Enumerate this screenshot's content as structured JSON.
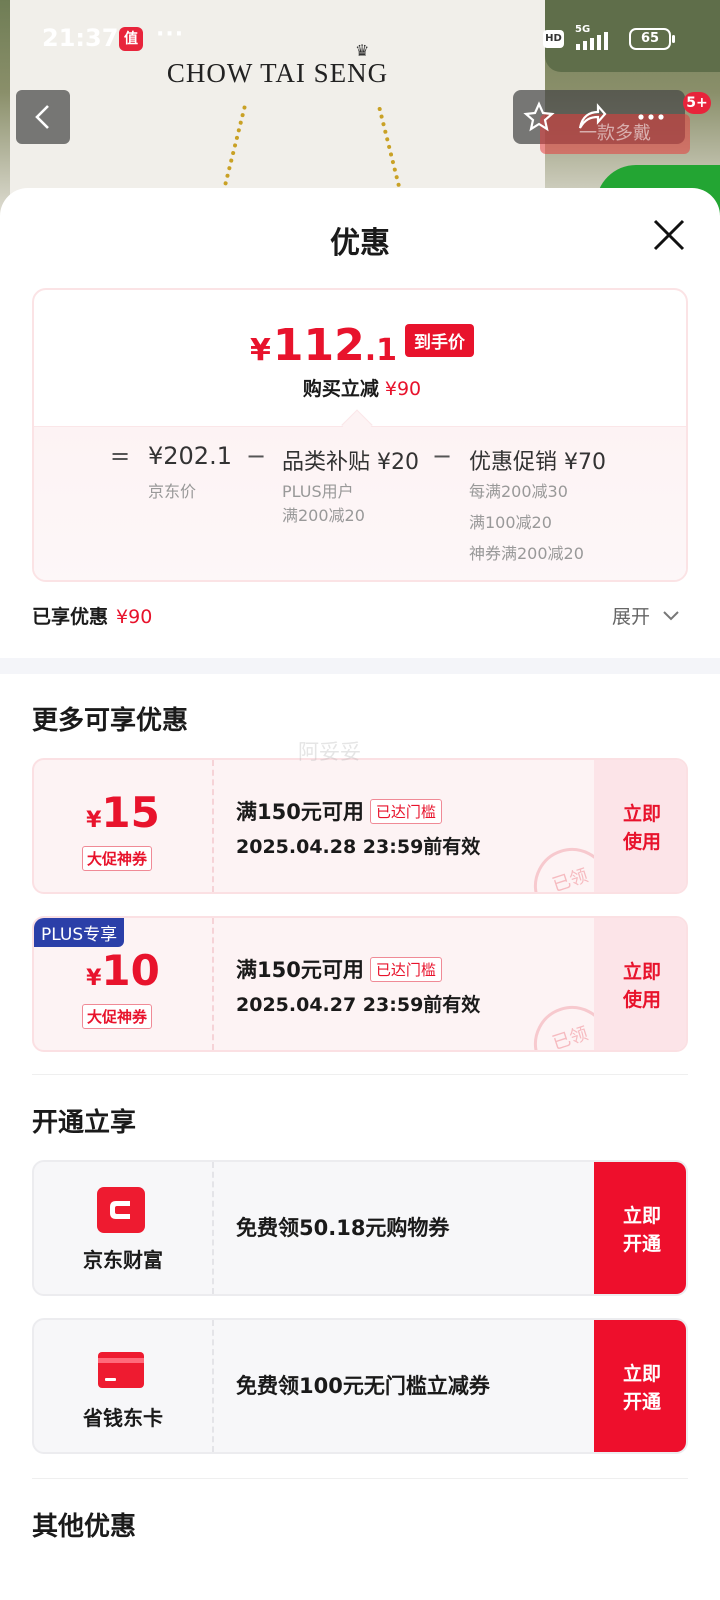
{
  "status_bar": {
    "time": "21:37",
    "app_badge": "值",
    "more_dots": "···",
    "hd": "HD",
    "network": "5G",
    "battery": "65"
  },
  "product_page": {
    "brand": "CHOW TAI SENG",
    "promo_ghost": "一款多戴",
    "cart_count": "5+",
    "icons": [
      "back-icon",
      "star-icon",
      "share-icon",
      "more-icon"
    ]
  },
  "sheet": {
    "title": "优惠",
    "close_icon": "close-icon"
  },
  "price": {
    "currency": "¥",
    "final_int": "112",
    "final_dec": ".1",
    "final_tag": "到手价",
    "discount_label": "购买立减",
    "discount_value": "¥90",
    "breakdown": {
      "eq": "=",
      "minus": "−",
      "jd_price": "¥202.1",
      "jd_price_label": "京东价",
      "subsidy_title": "品类补贴 ¥20",
      "subsidy_line1": "PLUS用户",
      "subsidy_line2": "满200减20",
      "promo_title": "优惠促销 ¥70",
      "promo_line1": "每满200减30",
      "promo_line2": "满100减20",
      "promo_line3": "神券满200减20"
    }
  },
  "enjoyed": {
    "label": "已享优惠",
    "value": "¥90",
    "expand_label": "展开"
  },
  "more_offers": {
    "title": "更多可享优惠",
    "watermark": "阿妥妥",
    "coupons": [
      {
        "currency": "¥",
        "amount": "15",
        "type": "大促神券",
        "condition": "满150元可用",
        "reached": "已达门槛",
        "valid": "2025.04.28 23:59前有效",
        "use_line1": "立即",
        "use_line2": "使用",
        "stamp": "已领"
      },
      {
        "badge": "PLUS专享",
        "currency": "¥",
        "amount": "10",
        "type": "大促神券",
        "condition": "满150元可用",
        "reached": "已达门槛",
        "valid": "2025.04.27 23:59前有效",
        "use_line1": "立即",
        "use_line2": "使用",
        "stamp": "已领"
      }
    ]
  },
  "open_offers": {
    "title": "开通立享",
    "items": [
      {
        "icon": "jd-wealth-icon",
        "name": "京东财富",
        "desc": "免费领50.18元购物券",
        "btn_line1": "立即",
        "btn_line2": "开通"
      },
      {
        "icon": "money-saving-card-icon",
        "name": "省钱东卡",
        "desc": "免费领100元无门槛立减券",
        "btn_line1": "立即",
        "btn_line2": "开通"
      }
    ]
  },
  "other_offers": {
    "title": "其他优惠"
  },
  "colors": {
    "accent_red": "#e8132c",
    "plus_blue": "#2b3fa8"
  }
}
